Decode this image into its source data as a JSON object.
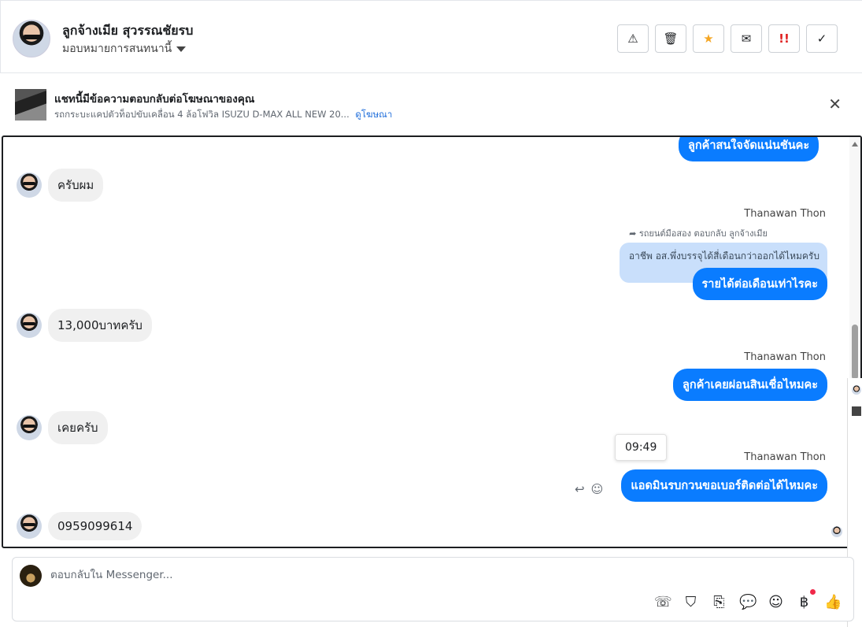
{
  "header": {
    "contact_name": "ลูกจ้างเมีย สุวรรณชัยรบ",
    "assign_label": "มอบหมายการสนทนานี้",
    "actions": [
      {
        "icon": "warning-icon",
        "glyph": "⚠"
      },
      {
        "icon": "trash-icon",
        "glyph": "🗑"
      },
      {
        "icon": "star-icon",
        "glyph": "★",
        "color": "#f5a623"
      },
      {
        "icon": "mail-icon",
        "glyph": "✉"
      },
      {
        "icon": "important-icon",
        "glyph": "!!",
        "color": "#e02020"
      },
      {
        "icon": "check-icon",
        "glyph": "✓"
      }
    ]
  },
  "ad": {
    "title": "แชทนี้มีข้อความตอบกลับต่อโฆษณาของคุณ",
    "subtitle": "รถกระบะแคปตัวท็อปขับเคลื่อน 4 ล้อโฟวิล ISUZU D-MAX ALL NEW 20...",
    "link": "ดูโฆษณา",
    "close": "✕"
  },
  "messages": {
    "out_top": "ลูกค้าสนใจจัดแน่นชันคะ",
    "in_1": "ครับผม",
    "sender_1": "Thanawan Thon",
    "reply_note": "รถยนต์มือสอง ตอบกลับ ลูกจ้างเมีย",
    "quoted": "อาชีพ อส.พึ่งบรรจุได้สี่เดือนกว่าออกได้ไหมครับ",
    "out_1": "รายได้ต่อเดือนเท่าไรคะ",
    "in_2": "13,000บาทครับ",
    "sender_2": "Thanawan Thon",
    "out_2": "ลูกค้าเคยผ่อนสินเชื่อไหมคะ",
    "in_3": "เคยครับ",
    "time_tip": "09:49",
    "sender_3": "Thanawan Thon",
    "out_3": "แอดมินรบกวนขอเบอร์ติดต่อได้ไหมคะ",
    "in_4": "0959099614"
  },
  "composer": {
    "placeholder": "ตอบกลับใน Messenger...",
    "tools": [
      "phone-add-icon",
      "shopping-bag-icon",
      "paperclip-icon",
      "chat-bubble-icon",
      "emoji-icon",
      "baht-icon",
      "thumbs-up-icon"
    ]
  },
  "colors": {
    "accent": "#0a7cff",
    "incoming": "#f0f0f0",
    "quoted": "#c9dffb"
  }
}
